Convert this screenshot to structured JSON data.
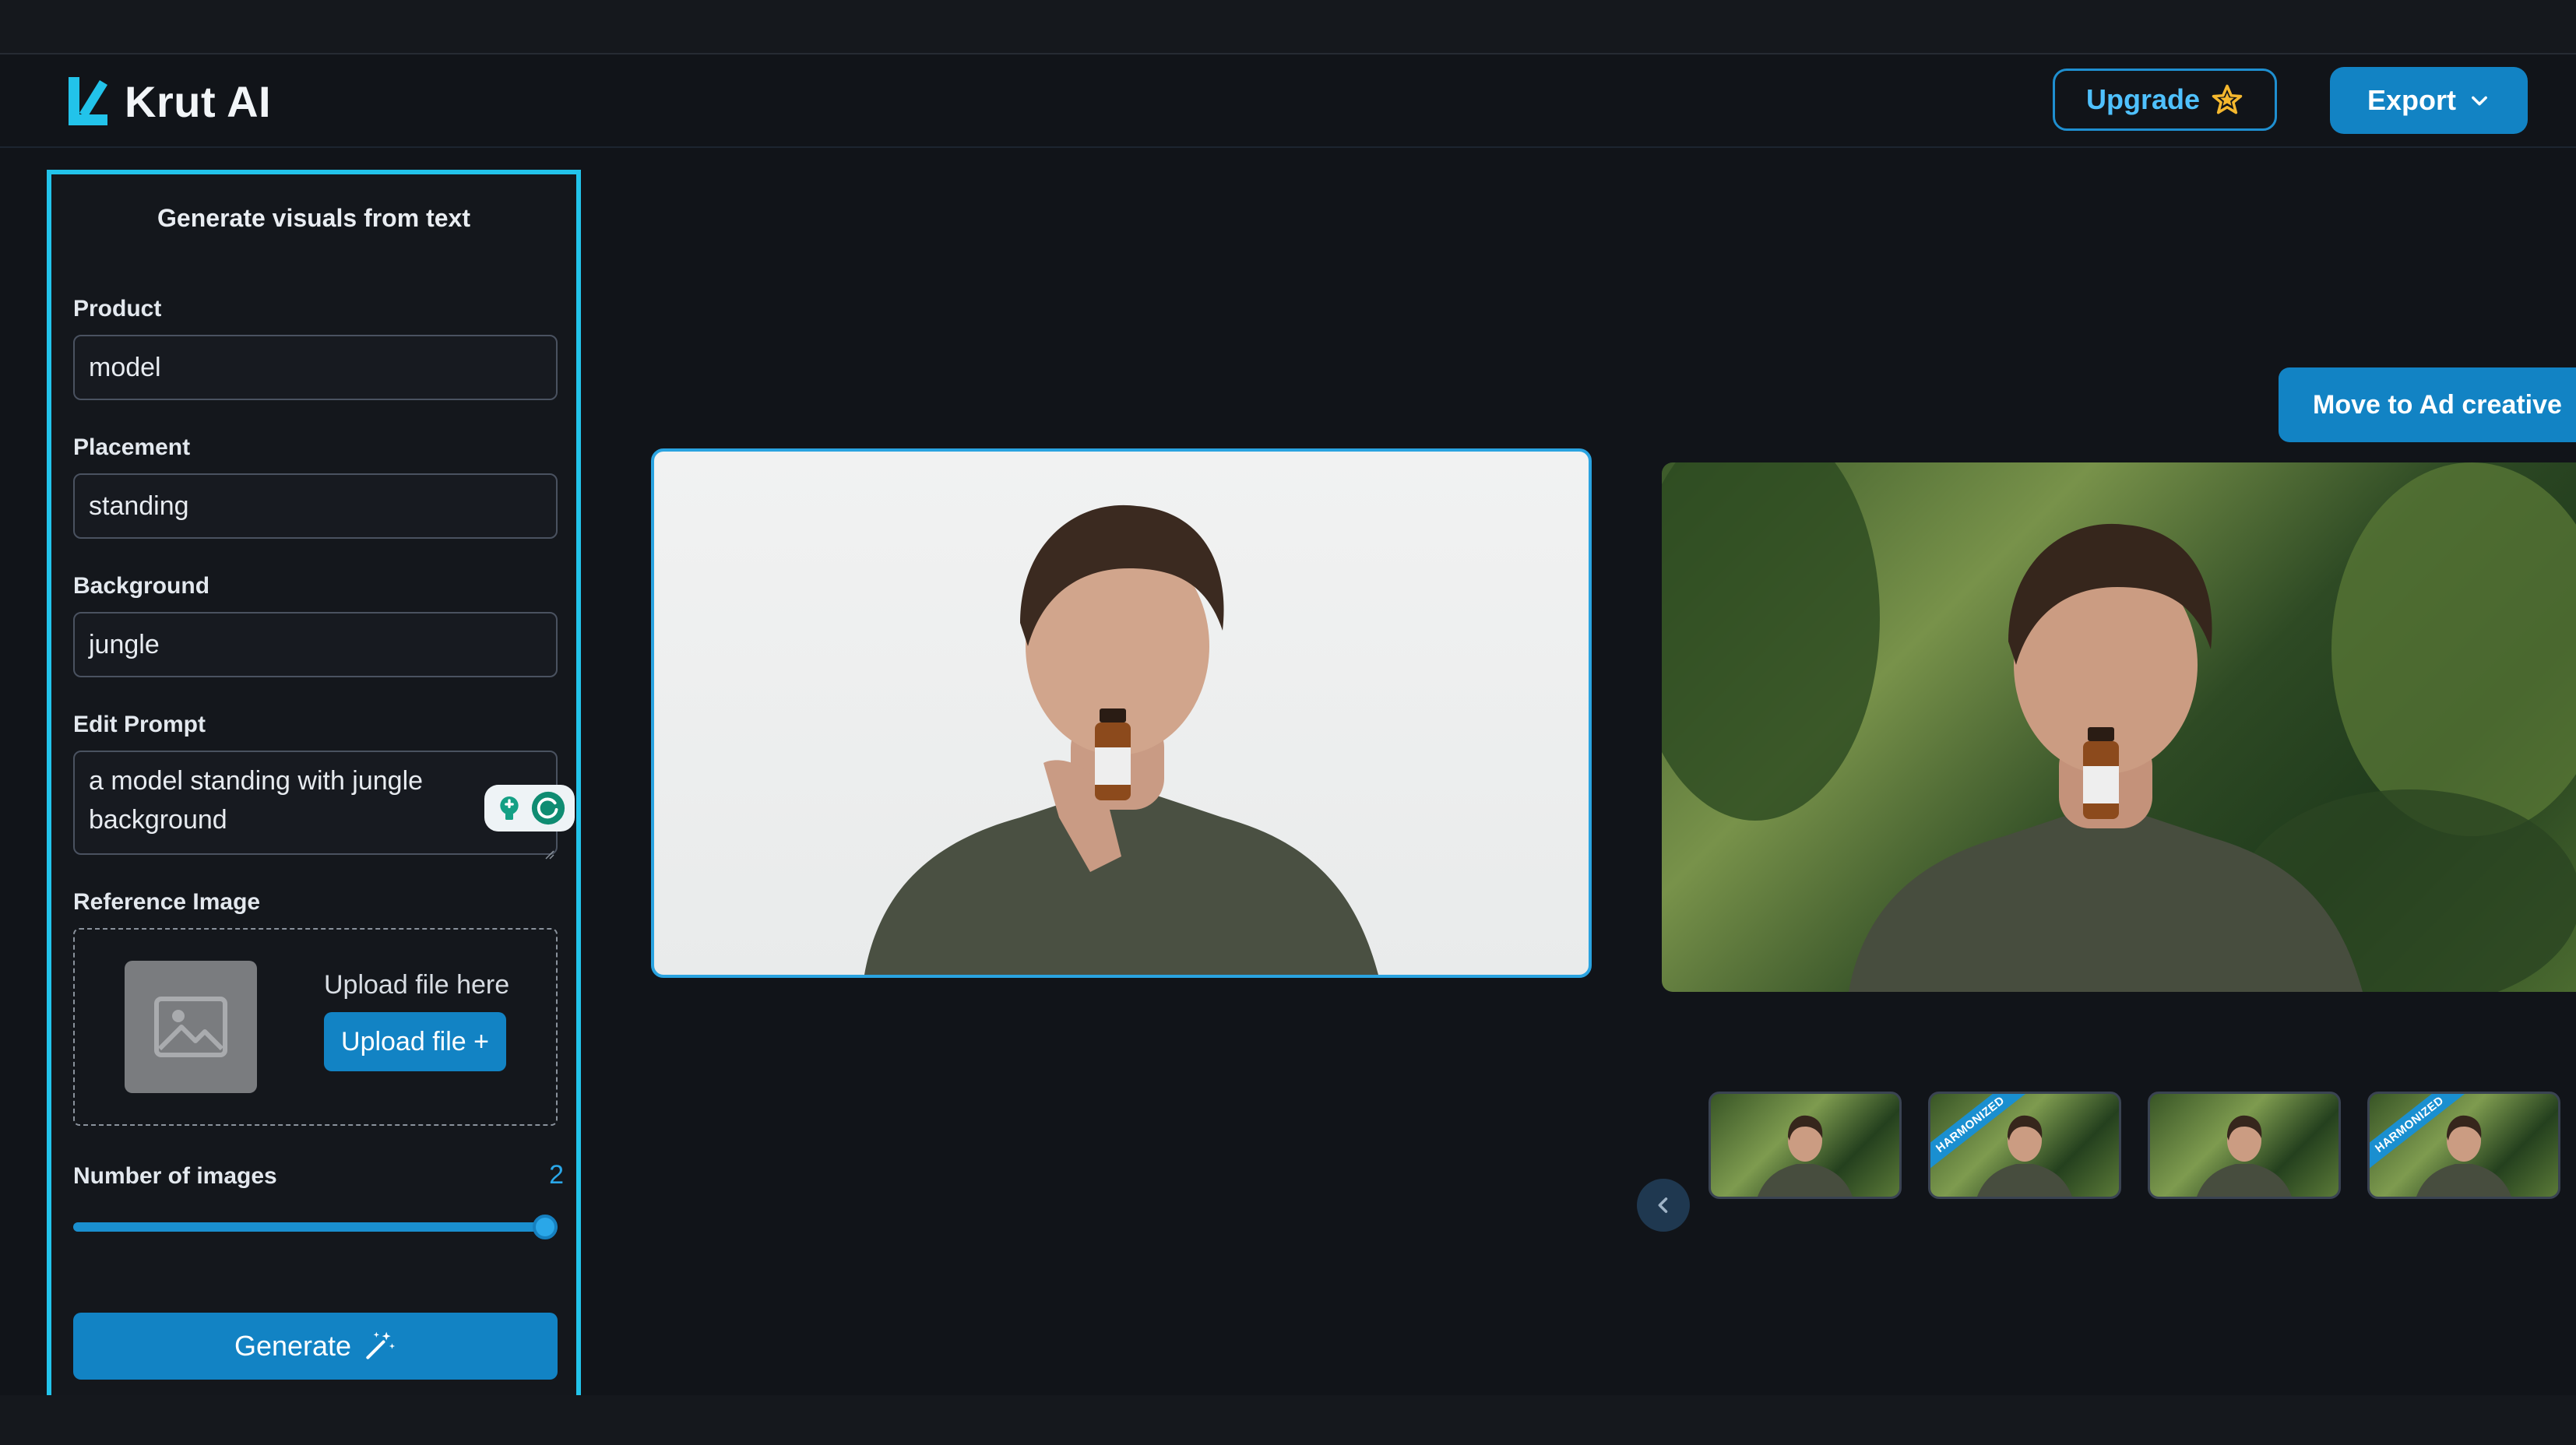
{
  "app": {
    "name": "Krut AI",
    "brand_color": "#22c3ea",
    "accent_color": "#1283c4"
  },
  "header": {
    "upgrade_label": "Upgrade",
    "export_label": "Export",
    "upgrade_icon": "star-icon",
    "export_icon": "chevron-down-icon"
  },
  "panel": {
    "title": "Generate visuals from text",
    "product": {
      "label": "Product",
      "value": "model"
    },
    "placement": {
      "label": "Placement",
      "value": "standing"
    },
    "background": {
      "label": "Background",
      "value": "jungle"
    },
    "edit_prompt": {
      "label": "Edit Prompt",
      "value": "a model standing with jungle background"
    },
    "reference_image": {
      "label": "Reference Image",
      "hint": "Upload file here",
      "button": "Upload file +"
    },
    "number_of_images": {
      "label": "Number of images",
      "value": "2",
      "fraction": 1.0
    },
    "generate_label": "Generate"
  },
  "canvas": {
    "move_button": "Move to Ad creative",
    "main_image": "man-holding-serum-bottle-white-background",
    "side_image": "man-holding-serum-bottle-jungle-background",
    "thumbnails": [
      {
        "image": "jungle-variant-1",
        "badge": ""
      },
      {
        "image": "jungle-variant-2",
        "badge": "HARMONIZED"
      },
      {
        "image": "jungle-variant-3",
        "badge": ""
      },
      {
        "image": "jungle-variant-4",
        "badge": "HARMONIZED"
      }
    ]
  }
}
